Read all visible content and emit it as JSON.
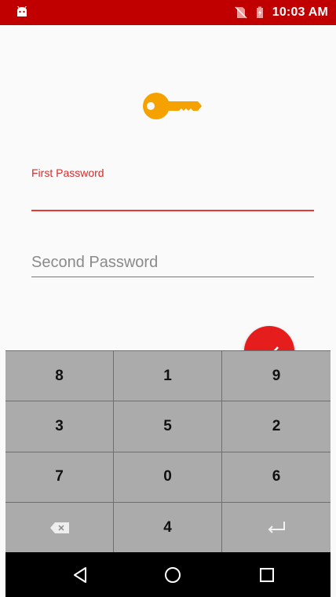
{
  "status_bar": {
    "time": "10:03 AM",
    "left_icon": "android-icon",
    "right_icons": [
      "no-sim-icon",
      "battery-charging-icon"
    ],
    "color": "#c00000"
  },
  "form": {
    "icon": "key-icon",
    "icon_color": "#f5a200",
    "first_password_label": "First Password",
    "first_password_value": "",
    "second_password_placeholder": "Second Password",
    "submit_icon": "check-icon",
    "accent_color": "#e53935"
  },
  "keypad": {
    "keys": [
      {
        "label": "8",
        "name": "key-8"
      },
      {
        "label": "1",
        "name": "key-1"
      },
      {
        "label": "9",
        "name": "key-9"
      },
      {
        "label": "3",
        "name": "key-3"
      },
      {
        "label": "5",
        "name": "key-5"
      },
      {
        "label": "2",
        "name": "key-2"
      },
      {
        "label": "7",
        "name": "key-7"
      },
      {
        "label": "0",
        "name": "key-0"
      },
      {
        "label": "6",
        "name": "key-6"
      },
      {
        "label": "",
        "name": "backspace-key",
        "icon": "backspace-icon"
      },
      {
        "label": "4",
        "name": "key-4"
      },
      {
        "label": "",
        "name": "enter-key",
        "icon": "enter-icon"
      }
    ]
  },
  "nav_bar": {
    "buttons": [
      "back-icon",
      "home-icon",
      "recents-icon"
    ]
  }
}
